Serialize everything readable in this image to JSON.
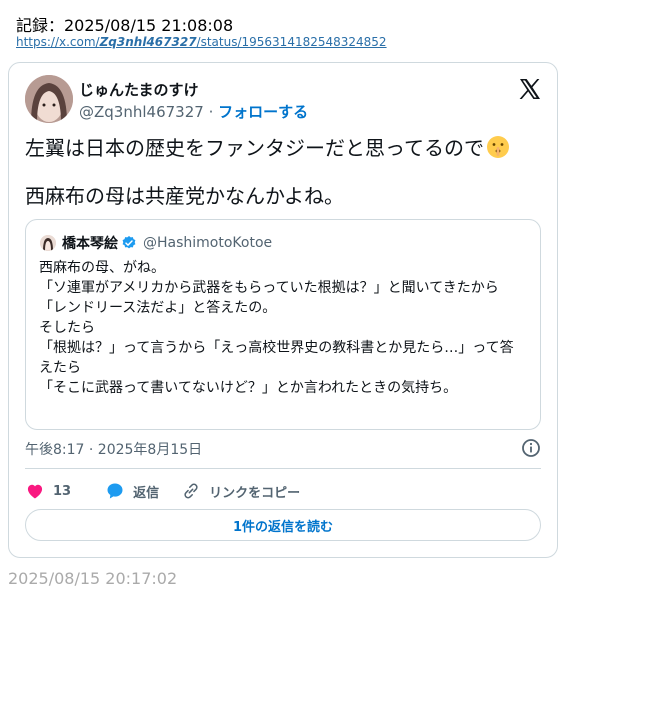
{
  "record": {
    "text": "記録：2025/08/15 21:08:08"
  },
  "link": {
    "prefix": "https://x.com/",
    "user": "Zq3nhl467327",
    "suffix": "/status/1956314182548324852"
  },
  "tweet": {
    "display_name": "じゅんたまのすけ",
    "handle": "@Zq3nhl467327",
    "separator": " · ",
    "follow_label": "フォローする",
    "line1": "左翼は日本の歴史をファンタジーだと思ってるので",
    "emoji": "shushing-face-icon",
    "line2": "西麻布の母は共産党かなんかよね。",
    "timestamp": "午後8:17 · 2025年8月15日",
    "like_count": "13",
    "reply_label": "返信",
    "copy_link_label": "リンクをコピー",
    "read_replies_label": "1件の返信を読む"
  },
  "quote": {
    "display_name": "橋本琴絵",
    "handle": "@HashimotoKotoe",
    "lines": [
      "西麻布の母、がね。",
      "「ソ連軍がアメリカから武器をもらっていた根拠は？」と聞いてきたから",
      "「レンドリース法だよ」と答えたの。",
      "そしたら",
      "「根拠は？」って言うから「えっ高校世界史の教科書とか見たら…」って答えたら",
      "「そこに武器って書いてないけど？」とか言われたときの気持ち。"
    ]
  },
  "footer": {
    "time": "2025/08/15 20:17:02"
  },
  "colors": {
    "link": "#0074cc",
    "like": "#f91880",
    "muted": "#536471",
    "border": "#cfd9de"
  }
}
